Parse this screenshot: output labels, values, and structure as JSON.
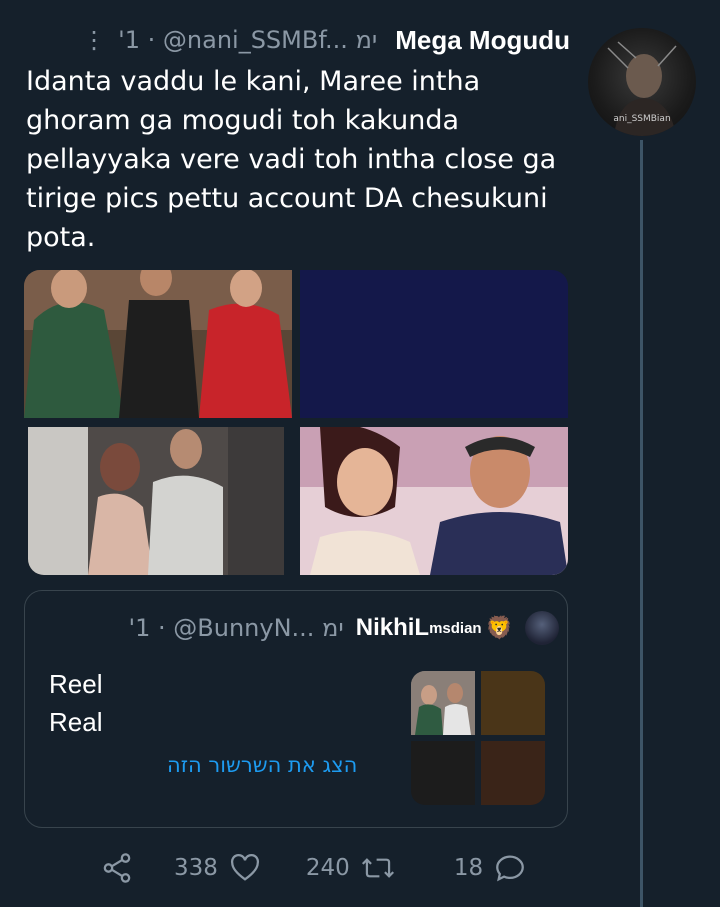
{
  "tweet": {
    "display_name": "Mega Mogudu",
    "meta": "'1 · @nani_SSMBf... ימ",
    "text": "Idanta vaddu le kani, Maree intha ghoram ga mogudi toh kakunda pellayyaka vere vadi toh intha close ga tirige pics pettu account DA chesukuni pota.",
    "avatar_caption": "ani_SSMBian"
  },
  "quote": {
    "display_name": "NikhiL",
    "name_superscript": "msdian",
    "emoji": "🦁",
    "meta": "'1 · @BunnyN... ימ",
    "text_line1": "Reel",
    "text_line2": "Real",
    "show_thread_link": "הצג את השרשור הזה"
  },
  "actions": {
    "likes": "338",
    "retweets": "240",
    "replies": "18"
  },
  "colors": {
    "background": "#15202b",
    "muted": "#8b98a5",
    "accent": "#1d9bf0",
    "border": "#38444d"
  }
}
